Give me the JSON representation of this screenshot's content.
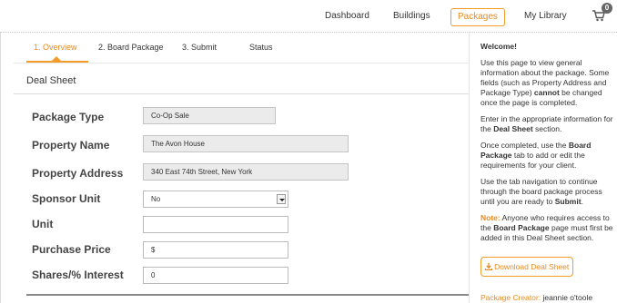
{
  "nav": {
    "items": [
      "Dashboard",
      "Buildings",
      "Packages",
      "My Library"
    ],
    "active": "Packages",
    "cart_count": "0"
  },
  "tabs": [
    "1. Overview",
    "2. Board Package",
    "3. Submit",
    "Status"
  ],
  "section_title": "Deal Sheet",
  "form": {
    "package_type": {
      "label": "Package Type",
      "value": "Co-Op Sale"
    },
    "property_name": {
      "label": "Property Name",
      "value": "The Avon House"
    },
    "property_address": {
      "label": "Property Address",
      "value": "340 East 74th Street, New York"
    },
    "sponsor_unit": {
      "label": "Sponsor Unit",
      "value": "No"
    },
    "unit": {
      "label": "Unit",
      "value": ""
    },
    "purchase_price": {
      "label": "Purchase Price",
      "value": "$"
    },
    "shares": {
      "label": "Shares/% Interest",
      "value": "0"
    }
  },
  "sidebar": {
    "title": "Welcome!",
    "p1a": "Use this page to view general information about the package. Some fields (such as Property Address and Package Type) ",
    "p1b": "cannot",
    "p1c": " be changed once the page is completed.",
    "p2a": "Enter in the appropriate information for the ",
    "p2b": "Deal Sheet",
    "p2c": " section.",
    "p3a": "Once completed, use the ",
    "p3b": "Board Package",
    "p3c": " tab to add or edit the requirements for your client.",
    "p4a": "Use the tab navigation to continue through the board package process until you are ready to ",
    "p4b": "Submit",
    "p4c": ".",
    "note_label": "Note:",
    "note_a": " Anyone who requires access to the ",
    "note_b": "Board Package",
    "note_c": " page must first be added in this Deal Sheet section.",
    "download_label": "Download Deal Sheet",
    "creator_key": "Package Creator:",
    "creator_value": "jeannie o'toole"
  },
  "colors": {
    "accent": "#f39c2a",
    "accent_text": "#e8891e"
  }
}
